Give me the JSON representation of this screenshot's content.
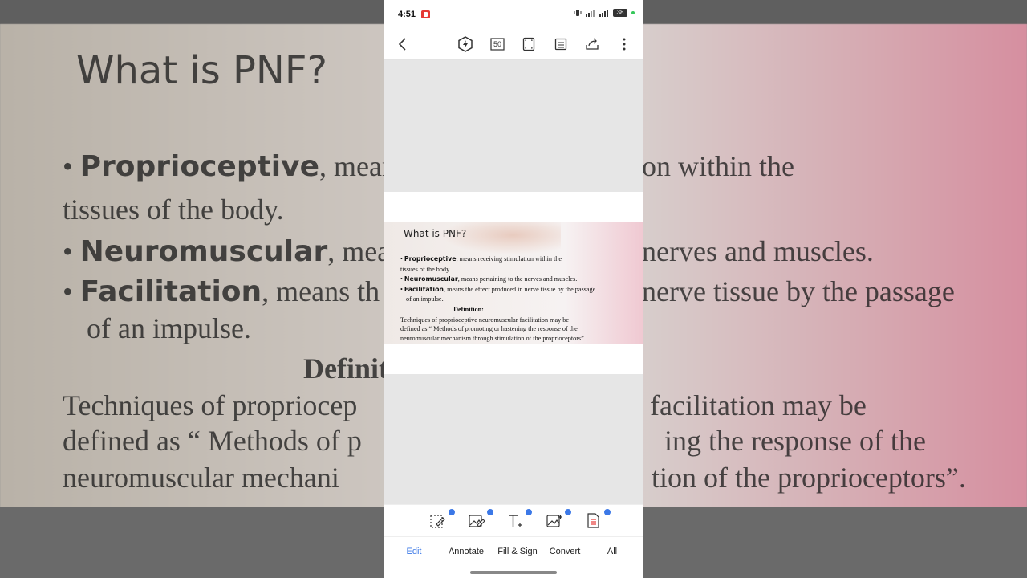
{
  "status_bar": {
    "time": "4:51",
    "battery": "38"
  },
  "toolbar": {
    "page_count_label": "50"
  },
  "slide": {
    "title": "What is PNF?",
    "b1_term": "Proprioceptive",
    "b1_text": ", means receiving stimulation  within the",
    "b1_cont": "tissues of the body.",
    "b2_term": "Neuromuscular",
    "b2_text": ", means pertaining to the nerves and  muscles.",
    "b3_term": "Facilitation",
    "b3_text": ", means the effect produced in nerve tissue  by the passage",
    "b3_cont": "of an impulse.",
    "def_heading": "Definition:",
    "def_line1": "Techniques of proprioceptive neuromuscular facilitation may be",
    "def_line2": "defined as “ Methods of promoting  or hastening the response of the",
    "def_line3": "neuromuscular  mechanism through stimulation of the proprioceptors”."
  },
  "background": {
    "title": "What is PNF?",
    "l1_term": "Proprioceptive",
    "l1_a": ", means",
    "l1_b": "on  within the",
    "l2": "tissues of the body.",
    "l3_term": "Neuromuscular",
    "l3_a": ", mear",
    "l3_b": "nerves and  muscles.",
    "l4_term": "Facilitation",
    "l4_a": ", means th",
    "l4_b": "nerve tissue  by the passage",
    "l5": "of an impulse.",
    "def": "Definit",
    "d1_a": "Techniques of propriocep",
    "d1_b": "facilitation may be",
    "d2_a": "defined as “ Methods of p",
    "d2_b": "ing the response of the",
    "d3_a": "neuromuscular  mechani",
    "d3_b": "tion of the proprioceptors”."
  },
  "bottom_tabs": [
    "Edit",
    "Annotate",
    "Fill & Sign",
    "Convert",
    "All"
  ],
  "accent_color": "#3b78e7"
}
